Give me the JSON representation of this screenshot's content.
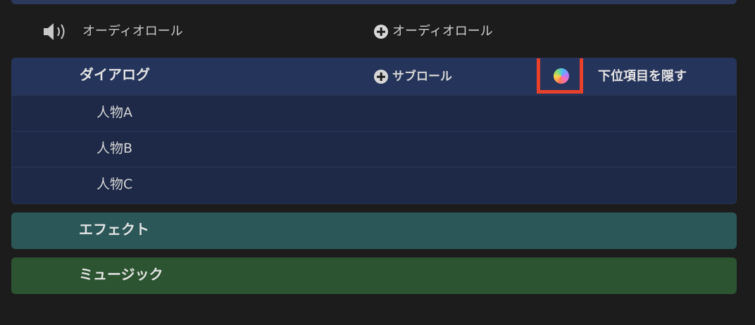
{
  "audio_role_row": {
    "label": "オーディオロール",
    "add_label": "オーディオロール",
    "icon": "speaker-icon"
  },
  "dialogue": {
    "title": "ダイアログ",
    "add_subrole_label": "サブロール",
    "color_swatch_icon": "color-wheel-icon",
    "hide_subitems_label": "下位項目を隠す",
    "subroles": [
      {
        "label": "人物A"
      },
      {
        "label": "人物B"
      },
      {
        "label": "人物C"
      }
    ]
  },
  "effects": {
    "label": "エフェクト"
  },
  "music": {
    "label": "ミュージック"
  },
  "colors": {
    "background": "#1c1c1d",
    "dialogue_header": "#25345a",
    "dialogue_body": "#1d2946",
    "effects": "#2b5758",
    "music": "#2c5431",
    "highlight": "#e8402b"
  }
}
